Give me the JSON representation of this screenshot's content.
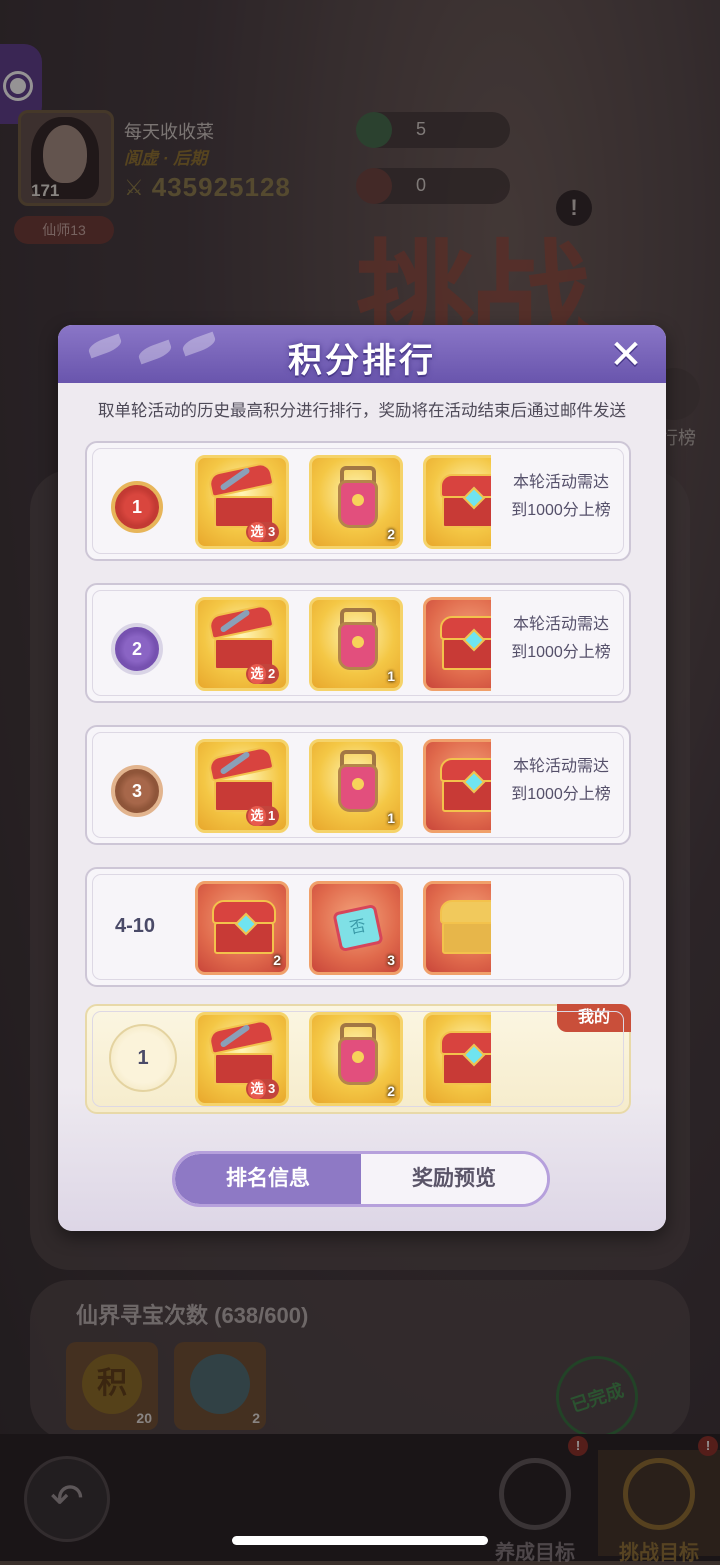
{
  "background": {
    "player": {
      "name": "每天收收菜",
      "title": "阆虚 · 后期",
      "level": "171",
      "power": "435925128",
      "rank_badge": "仙师13"
    },
    "resources": [
      {
        "icon": "herb-icon",
        "value": "5"
      },
      {
        "icon": "dragon-icon",
        "value": "0"
      }
    ],
    "challenge_banner": "挑战",
    "ranking_button_label": "行榜",
    "treasure_section": {
      "title": "仙界寻宝次数 (638/600)",
      "items": [
        {
          "icon": "points-coin-icon",
          "glyph": "积",
          "count": "20"
        },
        {
          "icon": "compass-icon",
          "glyph": "",
          "count": "2"
        }
      ],
      "done_stamp": "已完成"
    },
    "bottom_nav": {
      "back": "back-arrow-icon",
      "tabs": [
        {
          "label": "养成目标",
          "badge": "!",
          "active": false
        },
        {
          "label": "挑战目标",
          "badge": "!",
          "active": true
        }
      ]
    }
  },
  "modal": {
    "title": "积分排行",
    "description": "取单轮活动的历史最高积分进行排行，奖励将在活动结束后通过邮件发送",
    "rows": [
      {
        "rank": "1",
        "rank_type": "gold-medal",
        "requirement": [
          "本轮活动需达",
          "到1000分上榜"
        ],
        "items": [
          {
            "kind": "weapon-chest",
            "style": "gold",
            "count": "3",
            "selectable": true,
            "pick_label": "选"
          },
          {
            "kind": "flower-basket",
            "style": "gold",
            "count": "2",
            "selectable": false
          },
          {
            "kind": "treasure-chest",
            "style": "gold",
            "count": "",
            "selectable": false
          }
        ]
      },
      {
        "rank": "2",
        "rank_type": "silver-medal",
        "requirement": [
          "本轮活动需达",
          "到1000分上榜"
        ],
        "items": [
          {
            "kind": "weapon-chest",
            "style": "gold",
            "count": "2",
            "selectable": true,
            "pick_label": "选"
          },
          {
            "kind": "flower-basket",
            "style": "gold",
            "count": "1",
            "selectable": false
          },
          {
            "kind": "treasure-chest",
            "style": "red",
            "count": "",
            "selectable": false
          }
        ]
      },
      {
        "rank": "3",
        "rank_type": "bronze-medal",
        "requirement": [
          "本轮活动需达",
          "到1000分上榜"
        ],
        "items": [
          {
            "kind": "weapon-chest",
            "style": "gold",
            "count": "1",
            "selectable": true,
            "pick_label": "选"
          },
          {
            "kind": "flower-basket",
            "style": "gold",
            "count": "1",
            "selectable": false
          },
          {
            "kind": "treasure-chest",
            "style": "red",
            "count": "",
            "selectable": false
          }
        ]
      },
      {
        "rank": "4-10",
        "rank_type": "text",
        "requirement": [],
        "items": [
          {
            "kind": "treasure-chest",
            "style": "red",
            "count": "2",
            "selectable": false
          },
          {
            "kind": "ticket",
            "style": "red",
            "count": "3",
            "selectable": false,
            "glyph": "否"
          },
          {
            "kind": "golden-chest",
            "style": "red",
            "count": "",
            "selectable": false
          }
        ]
      }
    ],
    "my_row": {
      "tag": "我的",
      "rank": "1",
      "items": [
        {
          "kind": "weapon-chest",
          "style": "gold",
          "count": "3",
          "selectable": true,
          "pick_label": "选"
        },
        {
          "kind": "flower-basket",
          "style": "gold",
          "count": "2",
          "selectable": false
        },
        {
          "kind": "treasure-chest",
          "style": "gold",
          "count": "",
          "selectable": false
        }
      ]
    },
    "tabs": [
      {
        "label": "排名信息",
        "active": true
      },
      {
        "label": "奖励预览",
        "active": false
      }
    ],
    "close_icon": "close-x-icon"
  },
  "colors": {
    "modal_header": "#6955ad",
    "active_tab": "#8e79c5",
    "mine_tag": "#c94f3a",
    "gold_item": "#f4c745",
    "red_item": "#e06a4c"
  }
}
